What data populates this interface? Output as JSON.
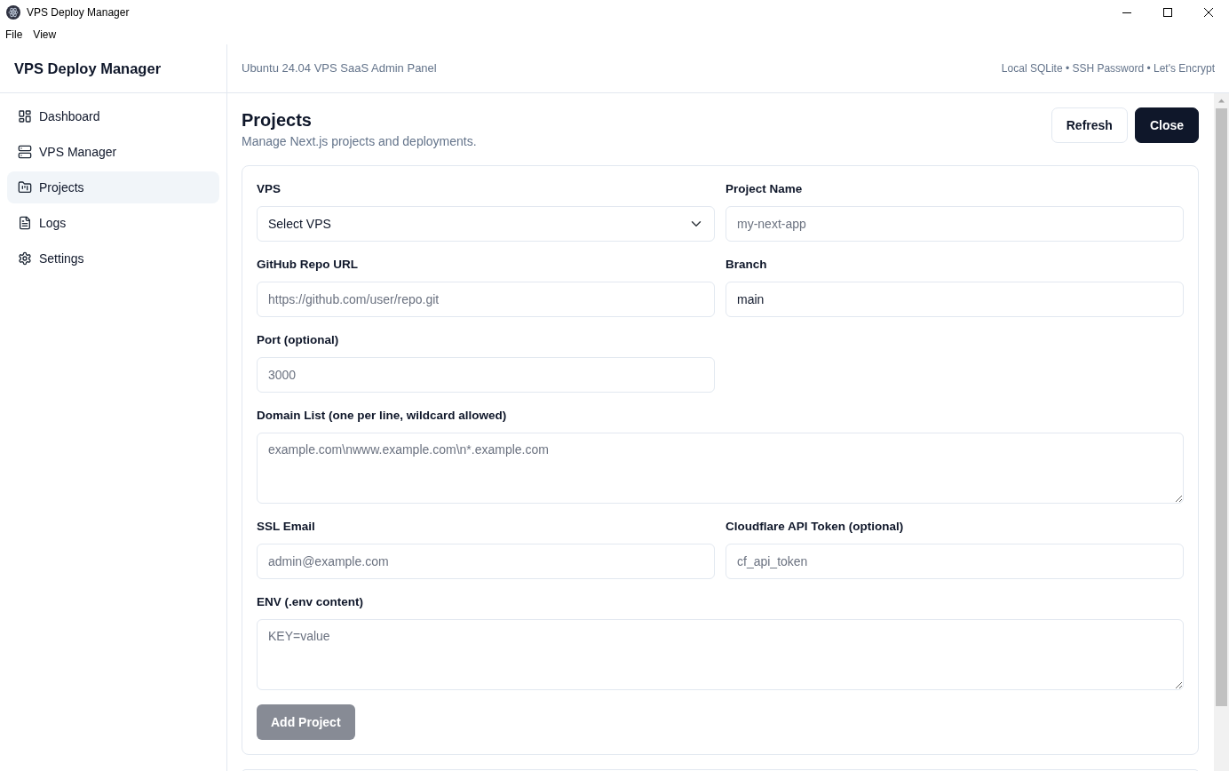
{
  "window": {
    "title": "VPS Deploy Manager"
  },
  "menu_bar": [
    "File",
    "View"
  ],
  "sidebar": {
    "brand": "VPS Deploy Manager",
    "items": [
      {
        "label": "Dashboard",
        "selected": false
      },
      {
        "label": "VPS Manager",
        "selected": false
      },
      {
        "label": "Projects",
        "selected": true
      },
      {
        "label": "Logs",
        "selected": false
      },
      {
        "label": "Settings",
        "selected": false
      }
    ]
  },
  "header": {
    "title": "Ubuntu 24.04 VPS SaaS Admin Panel",
    "info": "Local SQLite • SSH Password • Let's Encrypt"
  },
  "page": {
    "title": "Projects",
    "subtitle": "Manage Next.js projects and deployments.",
    "buttons": [
      {
        "label": "Refresh",
        "kind": "outline"
      },
      {
        "label": "Close",
        "kind": "dark"
      }
    ]
  },
  "form": {
    "fields": [
      {
        "label": "VPS",
        "kind": "select",
        "value": "Select VPS"
      },
      {
        "label": "Project Name",
        "kind": "input",
        "placeholder": "my-next-app"
      },
      {
        "label": "GitHub Repo URL",
        "kind": "input",
        "placeholder": "https://github.com/user/repo.git"
      },
      {
        "label": "Branch",
        "kind": "input",
        "value": "main"
      },
      {
        "label": "Port (optional)",
        "kind": "input",
        "placeholder": "3000"
      },
      {
        "label": "Domain List (one per line, wildcard allowed)",
        "kind": "textarea",
        "placeholder": "example.com\\nwww.example.com\\n*.example.com"
      },
      {
        "label": "SSL Email",
        "kind": "input",
        "placeholder": "admin@example.com"
      },
      {
        "label": "Cloudflare API Token (optional)",
        "kind": "input",
        "placeholder": "cf_api_token"
      },
      {
        "label": "ENV (.env content)",
        "kind": "textarea",
        "placeholder": "KEY=value"
      }
    ],
    "submit": {
      "label": "Add Project",
      "disabled": true
    }
  }
}
